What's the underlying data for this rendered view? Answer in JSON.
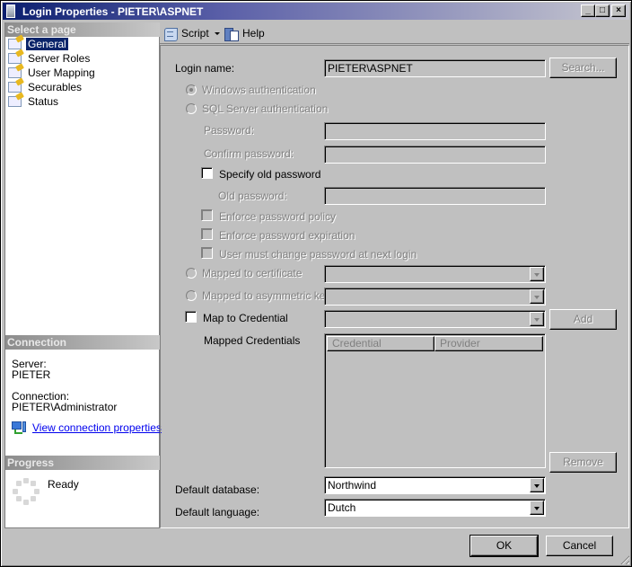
{
  "window": {
    "title": "Login Properties - PIETER\\ASPNET",
    "controls": {
      "minimize": "_",
      "maximize": "□",
      "close": "×"
    }
  },
  "left_panel": {
    "select_page_header": "Select a page",
    "pages": [
      {
        "label": "General",
        "icon": "page-icon",
        "selected": true
      },
      {
        "label": "Server Roles",
        "icon": "page-icon",
        "selected": false
      },
      {
        "label": "User Mapping",
        "icon": "page-icon",
        "selected": false
      },
      {
        "label": "Securables",
        "icon": "page-icon",
        "selected": false
      },
      {
        "label": "Status",
        "icon": "page-icon",
        "selected": false
      }
    ],
    "connection": {
      "header": "Connection",
      "server_label": "Server:",
      "server_value": "PIETER",
      "connection_label": "Connection:",
      "connection_value": "PIETER\\Administrator",
      "view_link": "View connection properties"
    },
    "progress": {
      "header": "Progress",
      "status": "Ready"
    }
  },
  "toolbar": {
    "script_label": "Script",
    "help_label": "Help"
  },
  "general": {
    "login_name_label": "Login name:",
    "login_name_value": "PIETER\\ASPNET",
    "search_button": "Search...",
    "windows_auth_label": "Windows authentication",
    "windows_auth_checked": true,
    "sql_auth_label": "SQL Server authentication",
    "sql_auth_checked": false,
    "password_label": "Password:",
    "password_value": "",
    "confirm_password_label": "Confirm password:",
    "confirm_password_value": "",
    "specify_old_password_label": "Specify old password",
    "specify_old_password_checked": false,
    "old_password_label": "Old password:",
    "old_password_value": "",
    "enforce_policy_label": "Enforce password policy",
    "enforce_expiration_label": "Enforce password expiration",
    "must_change_label": "User must change password at next login",
    "mapped_cert_label": "Mapped to certificate",
    "mapped_cert_value": "",
    "mapped_asym_label": "Mapped to asymmetric key",
    "mapped_asym_value": "",
    "map_credential_label": "Map to Credential",
    "map_credential_checked": false,
    "map_credential_value": "",
    "add_button": "Add",
    "mapped_credentials_label": "Mapped Credentials",
    "credentials_columns": [
      "Credential",
      "Provider"
    ],
    "credentials_rows": [],
    "remove_button": "Remove",
    "default_database_label": "Default database:",
    "default_database_value": "Northwind",
    "default_language_label": "Default language:",
    "default_language_value": "Dutch"
  },
  "footer": {
    "ok_button": "OK",
    "cancel_button": "Cancel"
  }
}
